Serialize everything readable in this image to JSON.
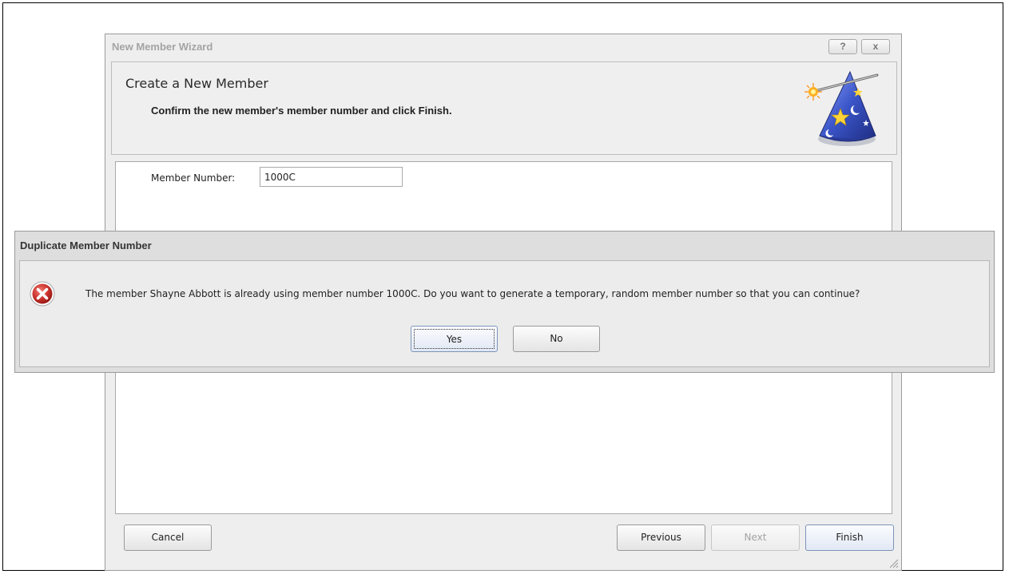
{
  "wizard": {
    "title": "New Member Wizard",
    "help_label": "?",
    "close_label": "x",
    "header_title": "Create a New Member",
    "header_subtitle": "Confirm the new member's member number and click Finish.",
    "icon": "wizard-hat-icon",
    "member_number_label": "Member Number:",
    "member_number_value": "1000C",
    "buttons": {
      "cancel": "Cancel",
      "previous": "Previous",
      "next": "Next",
      "finish": "Finish"
    }
  },
  "dialog": {
    "title": "Duplicate Member Number",
    "icon": "error-icon",
    "message": "The member Shayne Abbott is already using member number 1000C. Do you want to generate a temporary, random member number so that you can continue?",
    "yes_label": "Yes",
    "no_label": "No"
  },
  "colors": {
    "error_red": "#c8302a",
    "window_bg": "#eeeeee",
    "dialog_bg": "#dedede",
    "hat_blue": "#3a55c8"
  }
}
